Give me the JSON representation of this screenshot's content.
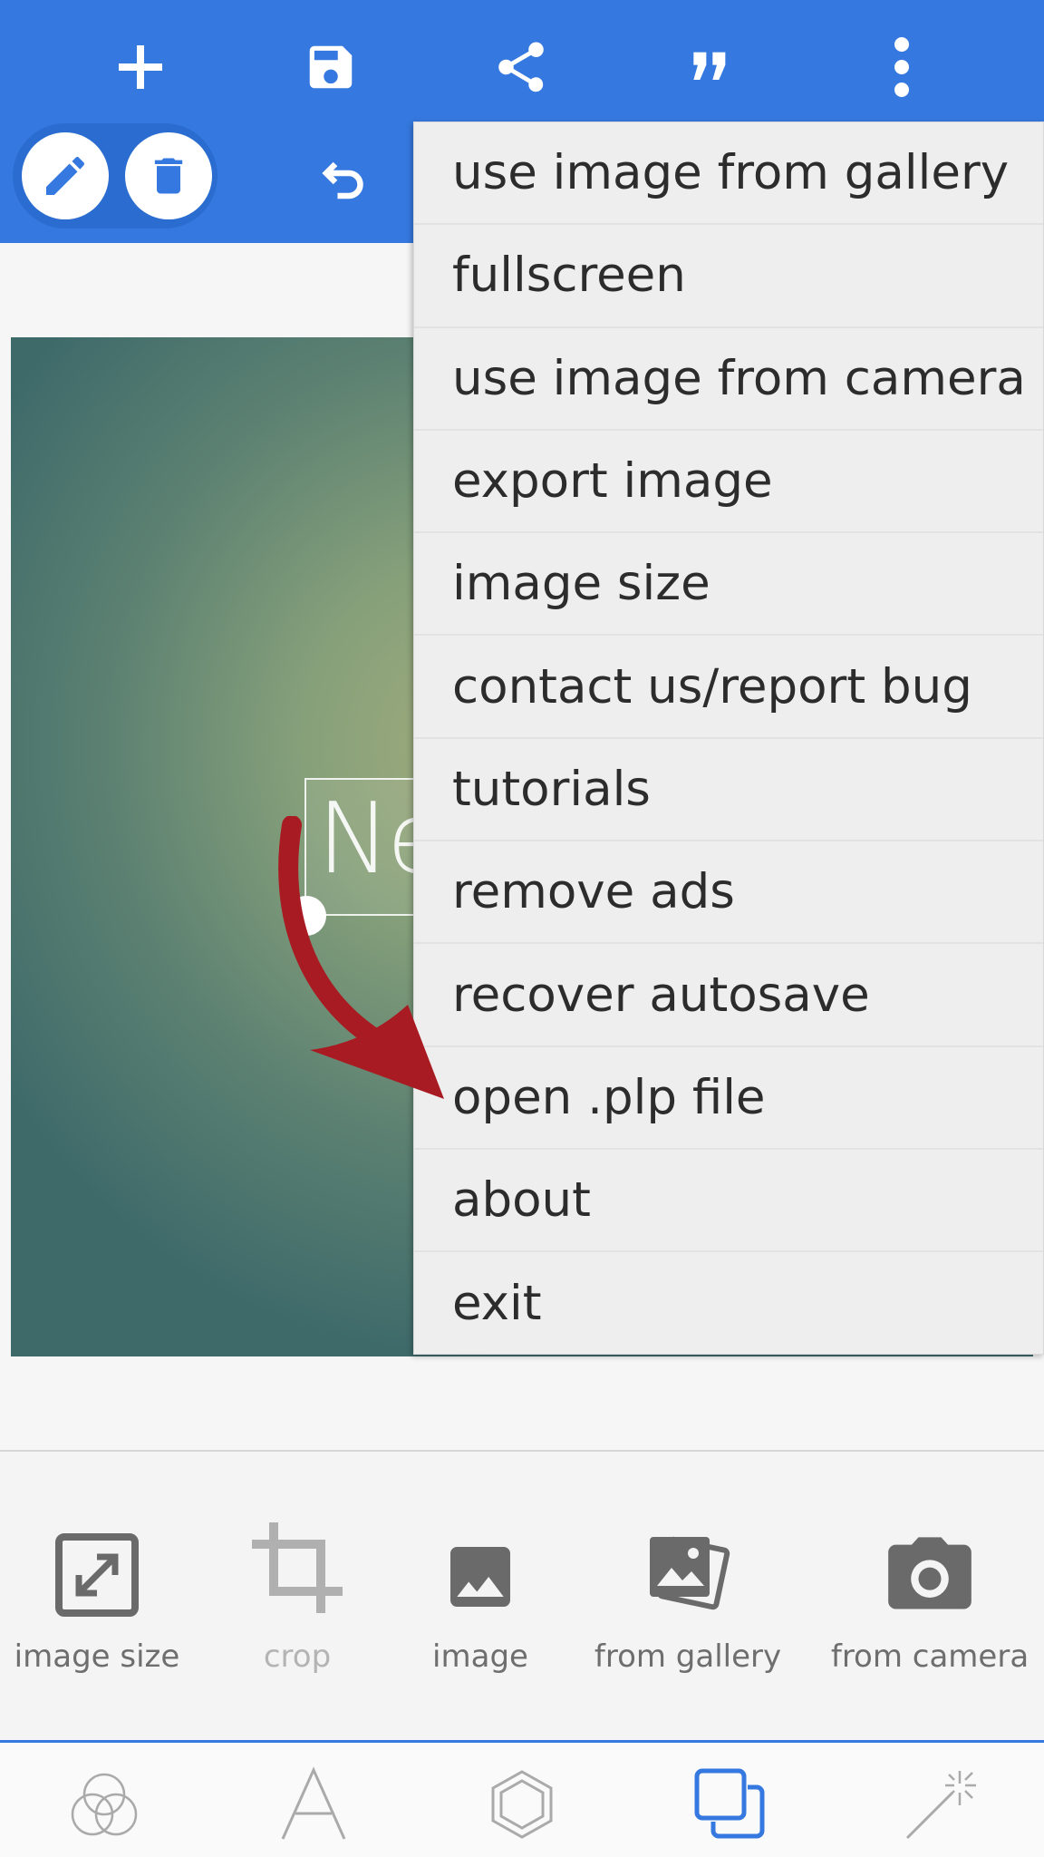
{
  "toolbar": {
    "icons": [
      "plus-icon",
      "save-icon",
      "share-icon",
      "quote-icon",
      "more-vert-icon"
    ],
    "row2_icons": [
      "pencil-icon",
      "trash-icon",
      "undo-icon"
    ]
  },
  "canvas": {
    "text_preview": "Ne"
  },
  "menu": {
    "items": [
      "use image from gallery",
      "fullscreen",
      "use image from camera",
      "export image",
      "image size",
      "contact us/report bug",
      "tutorials",
      "remove ads",
      "recover autosave",
      "open .plp file",
      "about",
      "exit"
    ]
  },
  "tools": [
    {
      "label": "image size",
      "icon": "resize-icon",
      "disabled": false
    },
    {
      "label": "crop",
      "icon": "crop-icon",
      "disabled": true
    },
    {
      "label": "image",
      "icon": "image-icon",
      "disabled": false
    },
    {
      "label": "from gallery",
      "icon": "gallery-icon",
      "disabled": false
    },
    {
      "label": "from camera",
      "icon": "camera-icon",
      "disabled": false
    }
  ],
  "bottom_nav": {
    "icons": [
      "circles-icon",
      "text-icon",
      "hexagon-icon",
      "layers-icon",
      "magic-wand-icon"
    ],
    "active": "layers-icon"
  },
  "colors": {
    "primary": "#3579e0",
    "annotation_arrow": "#a91b22",
    "menu_bg": "#eeeeee"
  }
}
